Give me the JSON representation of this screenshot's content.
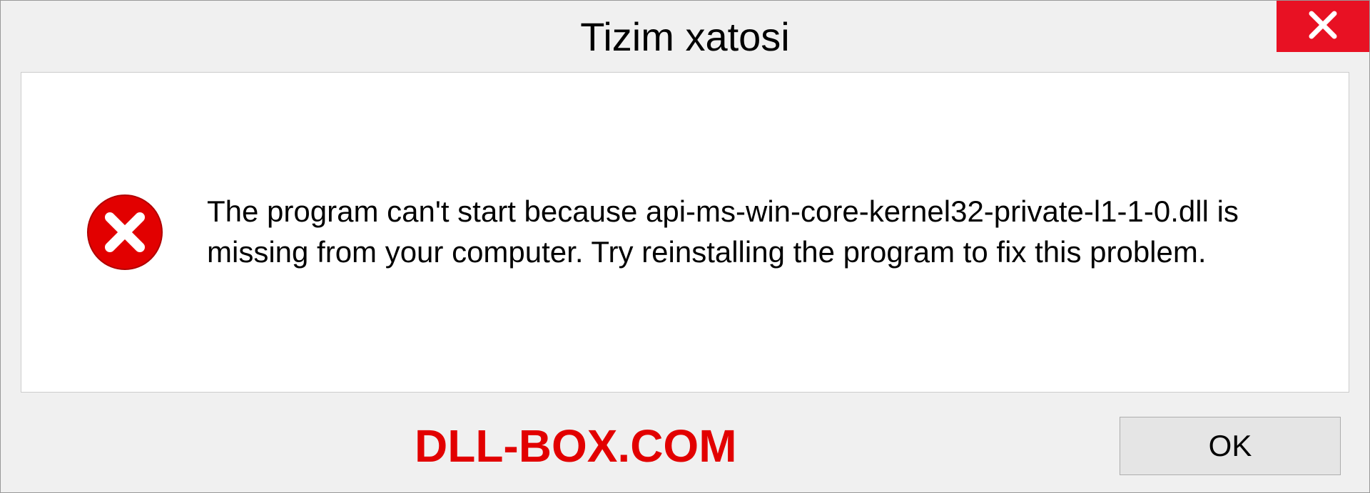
{
  "dialog": {
    "title": "Tizim xatosi",
    "message": "The program can't start because api-ms-win-core-kernel32-private-l1-1-0.dll is missing from your computer. Try reinstalling the program to fix this problem.",
    "ok_label": "OK"
  },
  "watermark": "DLL-BOX.COM",
  "colors": {
    "close_button": "#e81123",
    "error_icon": "#e20000",
    "watermark": "#e20000"
  }
}
